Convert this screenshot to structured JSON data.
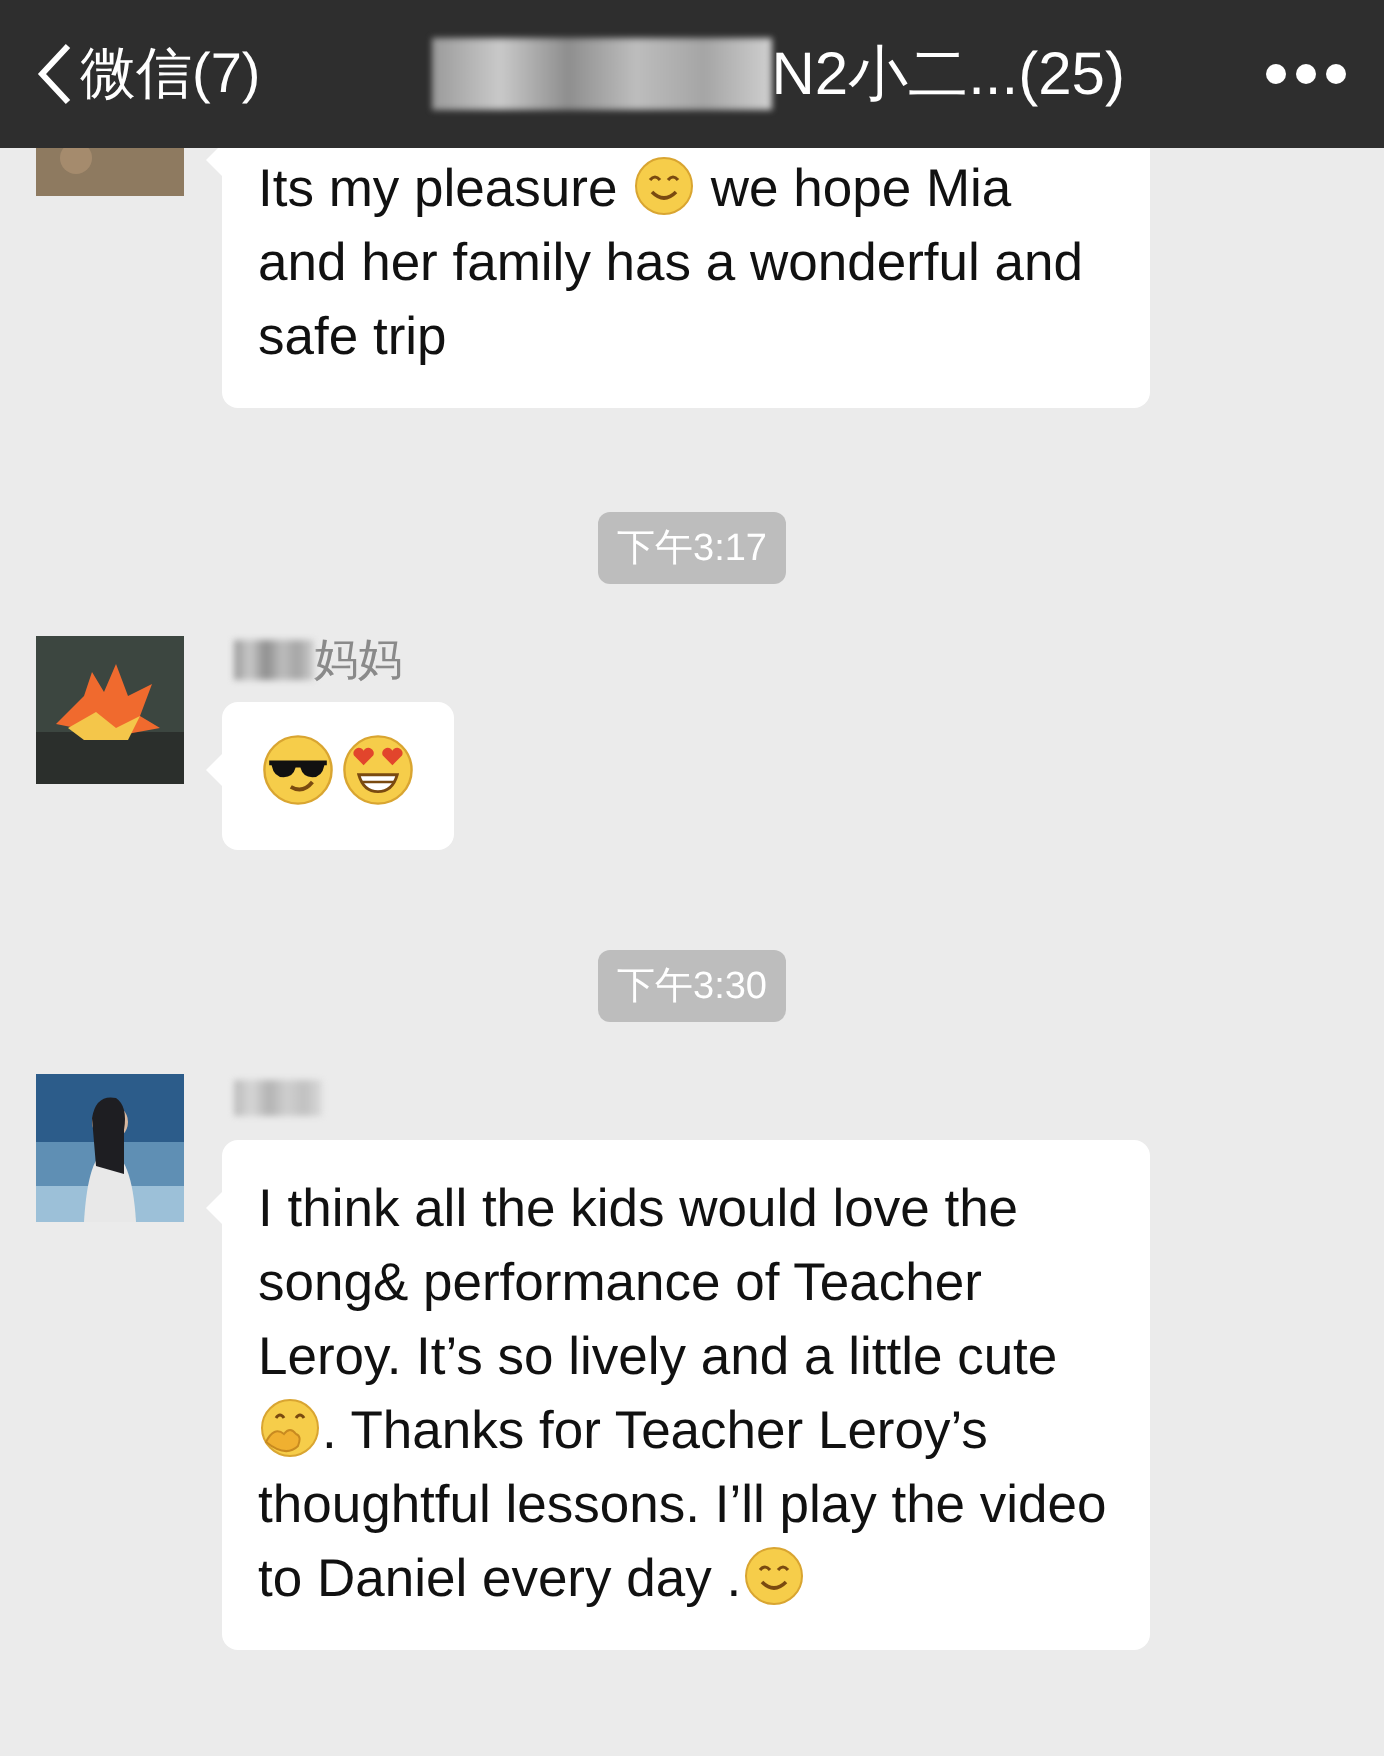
{
  "nav": {
    "back_label": "微信(7)",
    "title": "N2小二...(25)"
  },
  "items": [
    {
      "kind": "message",
      "segments": [
        {
          "kind": "text",
          "text": "Its my pleasure "
        },
        {
          "kind": "smile-emoji"
        },
        {
          "kind": "text",
          "text": " we hope Mia and her family has a wonderful and safe trip"
        }
      ]
    },
    {
      "kind": "timestamp",
      "text": "下午3:17"
    },
    {
      "kind": "message",
      "name": "妈妈",
      "segments": [
        {
          "kind": "sunglasses-emoji"
        },
        {
          "kind": "heart-eyes-emoji"
        }
      ]
    },
    {
      "kind": "timestamp",
      "text": "下午3:30"
    },
    {
      "kind": "message",
      "name_blurred": true,
      "segments": [
        {
          "kind": "text",
          "text": "I think all the kids would love the song& performance of Teacher Leroy. It’s so lively and a little cute"
        },
        {
          "kind": "hug-emoji"
        },
        {
          "kind": "text",
          "text": ". Thanks for Teacher Leroy’s thoughtful lessons. I’ll play the video to Daniel every day ."
        },
        {
          "kind": "smile-emoji"
        }
      ]
    }
  ]
}
